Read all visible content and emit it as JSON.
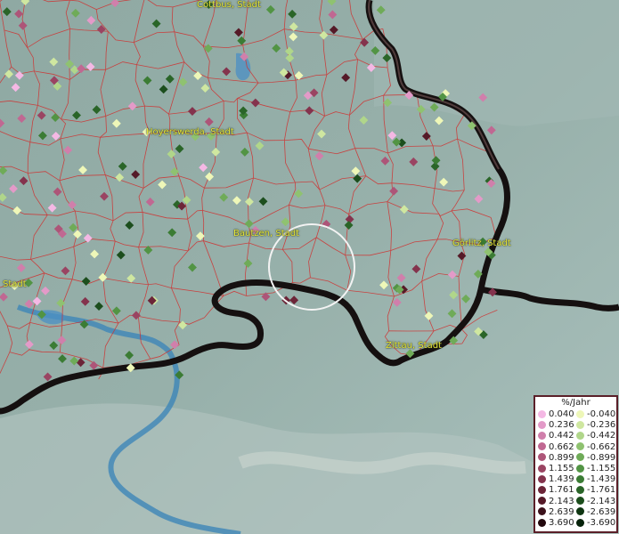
{
  "cities": [
    {
      "name": "Cottbus, Stadt"
    },
    {
      "name": "Hoyerswerda, Stadt"
    },
    {
      "name": "Bautzen, Stadt"
    },
    {
      "name": "Görlitz, Stadt"
    },
    {
      "name": "Zittau, Stadt"
    },
    {
      "name": "Stadt"
    }
  ],
  "legend": {
    "title": "%/Jahr",
    "positive": [
      {
        "label": "0.040",
        "color": "#f4b8e4"
      },
      {
        "label": "0.236",
        "color": "#e39ac8"
      },
      {
        "label": "0.442",
        "color": "#d07fab"
      },
      {
        "label": "0.662",
        "color": "#c06892"
      },
      {
        "label": "0.899",
        "color": "#ad5578"
      },
      {
        "label": "1.155",
        "color": "#9a4462"
      },
      {
        "label": "1.439",
        "color": "#84334d"
      },
      {
        "label": "1.761",
        "color": "#6c2538"
      },
      {
        "label": "2.143",
        "color": "#551a28"
      },
      {
        "label": "2.639",
        "color": "#3c111b"
      },
      {
        "label": "3.690",
        "color": "#22080d"
      }
    ],
    "negative": [
      {
        "label": "-0.040",
        "color": "#eef7b8"
      },
      {
        "label": "-0.236",
        "color": "#cfe7a0"
      },
      {
        "label": "-0.442",
        "color": "#b0d68a"
      },
      {
        "label": "-0.662",
        "color": "#8fc270"
      },
      {
        "label": "-0.899",
        "color": "#6fab58"
      },
      {
        "label": "-1.155",
        "color": "#529444"
      },
      {
        "label": "-1.439",
        "color": "#3b7c34"
      },
      {
        "label": "-1.761",
        "color": "#2a6528"
      },
      {
        "label": "-2.143",
        "color": "#1c4e1d"
      },
      {
        "label": "-2.639",
        "color": "#0f3612"
      },
      {
        "label": "-3.690",
        "color": "#06220a"
      }
    ]
  }
}
